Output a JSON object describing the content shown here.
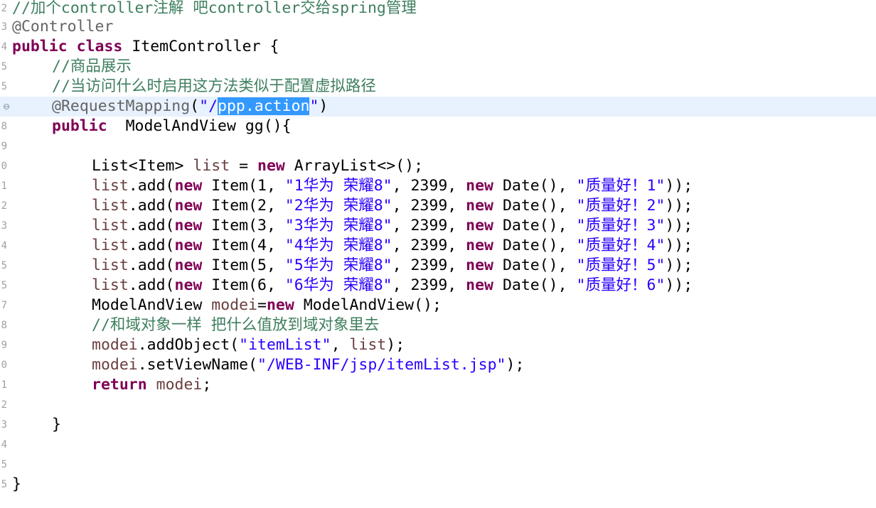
{
  "editor": {
    "gutter_numbers": [
      "2",
      "3",
      "4",
      "5",
      "5",
      "6",
      "8",
      "9",
      "0",
      "1",
      "2",
      "3",
      "4",
      "5",
      "5",
      "7",
      "8",
      "9",
      "0",
      "1",
      "2",
      "3",
      "4",
      "5",
      "5"
    ],
    "lines": {
      "l1": {
        "comment": "//加个controller注解 吧controller交给spring管理"
      },
      "l2": {
        "annotation": "@Controller"
      },
      "l3": {
        "kw_public": "public",
        "kw_class": "class",
        "rest": "ItemController {"
      },
      "l4": {
        "comment": "//商品展示"
      },
      "l5": {
        "comment": "//当访问什么时启用这方法类似于配置虚拟路径"
      },
      "l6": {
        "annotation": "@RequestMapping",
        "open": "(",
        "str_before": "\"/",
        "str_selected": "ppp.action",
        "str_after": "\"",
        "close": ")",
        "marker": "⊖"
      },
      "l7": {
        "kw_public": "public",
        "rest": "ModelAndView gg(){"
      },
      "l9": {
        "p1": "List<Item> ",
        "field": "list",
        "p2": " = ",
        "kw_new": "new",
        "p3": " ArrayList<>();"
      },
      "add_rows": [
        {
          "field": "list",
          "p1": ".add(",
          "kw_new1": "new",
          "p2": " Item(1, ",
          "str1": "\"1华为 荣耀8\"",
          "p3": ", 2399, ",
          "kw_new2": "new",
          "p4": " Date(), ",
          "str2": "\"质量好！1\"",
          "p5": "));"
        },
        {
          "field": "list",
          "p1": ".add(",
          "kw_new1": "new",
          "p2": " Item(2, ",
          "str1": "\"2华为 荣耀8\"",
          "p3": ", 2399, ",
          "kw_new2": "new",
          "p4": " Date(), ",
          "str2": "\"质量好！2\"",
          "p5": "));"
        },
        {
          "field": "list",
          "p1": ".add(",
          "kw_new1": "new",
          "p2": " Item(3, ",
          "str1": "\"3华为 荣耀8\"",
          "p3": ", 2399, ",
          "kw_new2": "new",
          "p4": " Date(), ",
          "str2": "\"质量好！3\"",
          "p5": "));"
        },
        {
          "field": "list",
          "p1": ".add(",
          "kw_new1": "new",
          "p2": " Item(4, ",
          "str1": "\"4华为 荣耀8\"",
          "p3": ", 2399, ",
          "kw_new2": "new",
          "p4": " Date(), ",
          "str2": "\"质量好！4\"",
          "p5": "));"
        },
        {
          "field": "list",
          "p1": ".add(",
          "kw_new1": "new",
          "p2": " Item(5, ",
          "str1": "\"5华为 荣耀8\"",
          "p3": ", 2399, ",
          "kw_new2": "new",
          "p4": " Date(), ",
          "str2": "\"质量好！5\"",
          "p5": "));"
        },
        {
          "field": "list",
          "p1": ".add(",
          "kw_new1": "new",
          "p2": " Item(6, ",
          "str1": "\"6华为 荣耀8\"",
          "p3": ", 2399, ",
          "kw_new2": "new",
          "p4": " Date(), ",
          "str2": "\"质量好！6\"",
          "p5": "));"
        }
      ],
      "l16": {
        "p1": "ModelAndView ",
        "field": "modei",
        "p2": "=",
        "kw_new": "new",
        "p3": " ModelAndView();"
      },
      "l17": {
        "comment": "//和域对象一样 把什么值放到域对象里去"
      },
      "l18": {
        "field": "modei",
        "p1": ".addObject(",
        "str": "\"itemList\"",
        "p2": ", ",
        "field2": "list",
        "p3": ");"
      },
      "l19": {
        "field": "modei",
        "p1": ".setViewName(",
        "str": "\"/WEB-INF/jsp/itemList.jsp\"",
        "p2": ");"
      },
      "l20": {
        "kw_return": "return",
        "sp": " ",
        "field": "modei",
        "p1": ";"
      },
      "l22": {
        "brace": "}"
      },
      "l25": {
        "brace": "}"
      }
    }
  }
}
